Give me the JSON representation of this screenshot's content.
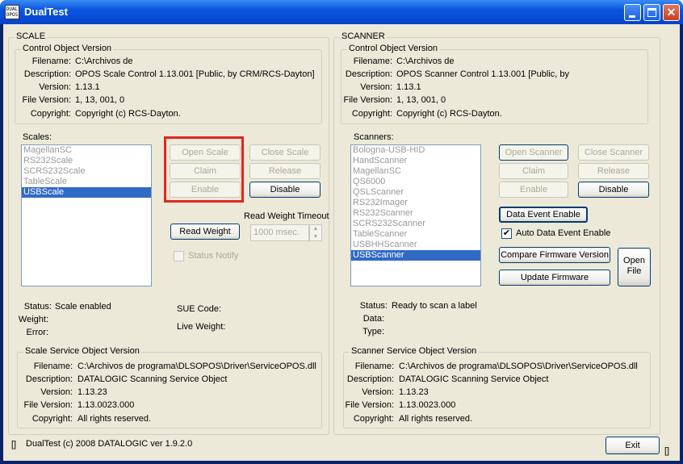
{
  "window": {
    "title": "DualTest",
    "icon_text": "DUAL OPOS"
  },
  "scale": {
    "group_title": "SCALE",
    "control": {
      "group_title": "Control Object Version",
      "filename_label": "Filename:",
      "filename": "C:\\Archivos de",
      "description_label": "Description:",
      "description": "OPOS Scale Control 1.13.001 [Public, by CRM/RCS-Dayton]",
      "version_label": "Version:",
      "version": "1.13.1",
      "file_version_label": "File Version:",
      "file_version": "1, 13, 001, 0",
      "copyright_label": "Copyright:",
      "copyright": "Copyright (c) RCS-Dayton."
    },
    "list_label": "Scales:",
    "list_items": [
      "MagellanSC",
      "RS232Scale",
      "SCRS232Scale",
      "TableScale",
      "USBScale"
    ],
    "selected": "USBScale",
    "buttons": {
      "open": "Open Scale",
      "close": "Close Scale",
      "claim": "Claim",
      "release": "Release",
      "enable": "Enable",
      "disable": "Disable",
      "read_weight": "Read Weight"
    },
    "timeout_label": "Read Weight Timeout",
    "timeout_value": "1000 msec.",
    "status_notify_label": "Status Notify",
    "status_label": "Status:",
    "status": "Scale enabled",
    "weight_label": "Weight:",
    "error_label": "Error:",
    "sue_label": "SUE Code:",
    "live_weight_label": "Live Weight:",
    "service": {
      "group_title": "Scale Service Object Version",
      "filename_label": "Filename:",
      "filename": "C:\\Archivos de programa\\DLSOPOS\\Driver\\ServiceOPOS.dll",
      "description_label": "Description:",
      "description": "DATALOGIC Scanning Service Object",
      "version_label": "Version:",
      "version": "1.13.23",
      "file_version_label": "File Version:",
      "file_version": "1.13.0023.000",
      "copyright_label": "Copyright:",
      "copyright": "All rights reserved."
    }
  },
  "scanner": {
    "group_title": "SCANNER",
    "control": {
      "group_title": "Control Object Version",
      "filename_label": "Filename:",
      "filename": "C:\\Archivos de",
      "description_label": "Description:",
      "description": "OPOS Scanner Control 1.13.001 [Public, by",
      "version_label": "Version:",
      "version": "1.13.1",
      "file_version_label": "File Version:",
      "file_version": "1, 13, 001, 0",
      "copyright_label": "Copyright:",
      "copyright": "Copyright (c) RCS-Dayton."
    },
    "list_label": "Scanners:",
    "list_items": [
      "Bologna-USB-HID",
      "HandScanner",
      "MagellanSC",
      "QS6000",
      "QSLScanner",
      "RS232Imager",
      "RS232Scanner",
      "SCRS232Scanner",
      "TableScanner",
      "USBHHScanner",
      "USBScanner"
    ],
    "selected": "USBScanner",
    "buttons": {
      "open": "Open Scanner",
      "close": "Close Scanner",
      "claim": "Claim",
      "release": "Release",
      "enable": "Enable",
      "disable": "Disable",
      "data_event_enable": "Data Event Enable",
      "compare_firmware": "Compare Firmware Version",
      "update_firmware": "Update Firmware",
      "open_file": "Open File"
    },
    "auto_data_event_label": "Auto Data Event Enable",
    "auto_data_event_checked": "✔",
    "status_label": "Status:",
    "status": "Ready to scan a label",
    "data_label": "Data:",
    "type_label": "Type:",
    "service": {
      "group_title": "Scanner Service Object Version",
      "filename_label": "Filename:",
      "filename": "C:\\Archivos de programa\\DLSOPOS\\Driver\\ServiceOPOS.dll",
      "description_label": "Description:",
      "description": "DATALOGIC Scanning Service Object",
      "version_label": "Version:",
      "version": "1.13.23",
      "file_version_label": "File Version:",
      "file_version": "1.13.0023.000",
      "copyright_label": "Copyright:",
      "copyright": "All rights reserved."
    }
  },
  "footer": {
    "left_mark": "[]",
    "text": "DualTest (c) 2008 DATALOGIC ver 1.9.2.0",
    "exit": "Exit",
    "right_mark": "[]"
  }
}
